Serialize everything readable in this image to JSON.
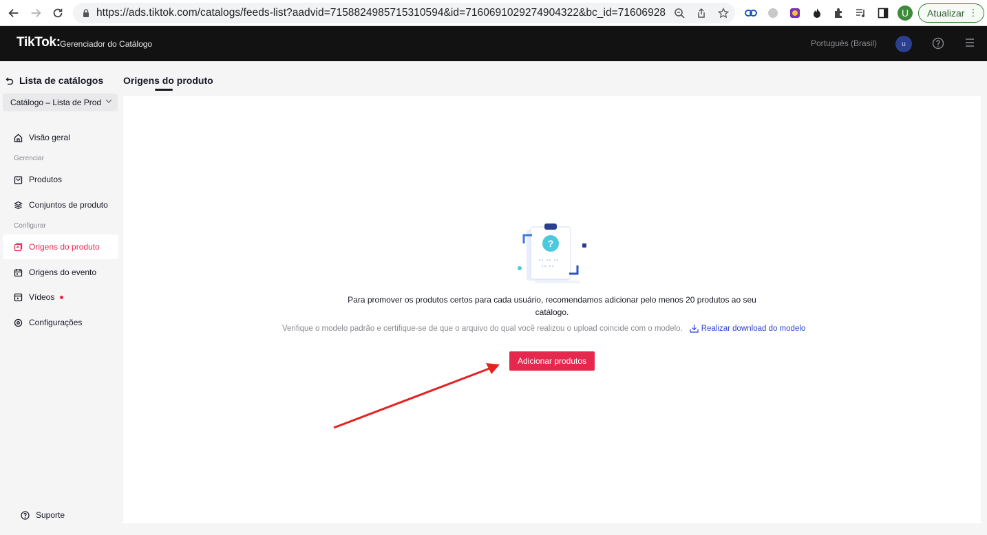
{
  "browser": {
    "url": "https://ads.tiktok.com/catalogs/feeds-list?aadvid=7158824985715310594&id=7160691029274904322&bc_id=716069281...",
    "profile_initial": "U",
    "update_label": "Atualizar"
  },
  "header": {
    "logo": "TikTok",
    "logo_suffix": ":",
    "subtitle": "Gerenciador do Catálogo",
    "language": "Português (Brasil)",
    "avatar_initial": "u"
  },
  "sidebar": {
    "back_label": "Lista de catálogos",
    "catalog_select": "Catálogo – Lista de Prod",
    "overview": "Visão geral",
    "section_manage": "Gerenciar",
    "products": "Produtos",
    "product_sets": "Conjuntos de produto",
    "section_config": "Configurar",
    "product_sources": "Origens do produto",
    "event_sources": "Origens do evento",
    "videos": "Vídeos",
    "settings": "Configurações",
    "support": "Suporte"
  },
  "main": {
    "tab_title": "Origens do produto",
    "promo_text": "Para promover os produtos certos para cada usuário, recomendamos adicionar pelo menos 20 produtos ao seu catálogo.",
    "hint_text": "Verifique o modelo padrão e certifique-se de que o arquivo do qual você realizou o upload coincide com o modelo.",
    "download_link": "Realizar download do modelo",
    "add_button": "Adicionar produtos"
  },
  "colors": {
    "accent": "#e5294e",
    "link": "#2b3fcf",
    "topbar": "#121212"
  }
}
